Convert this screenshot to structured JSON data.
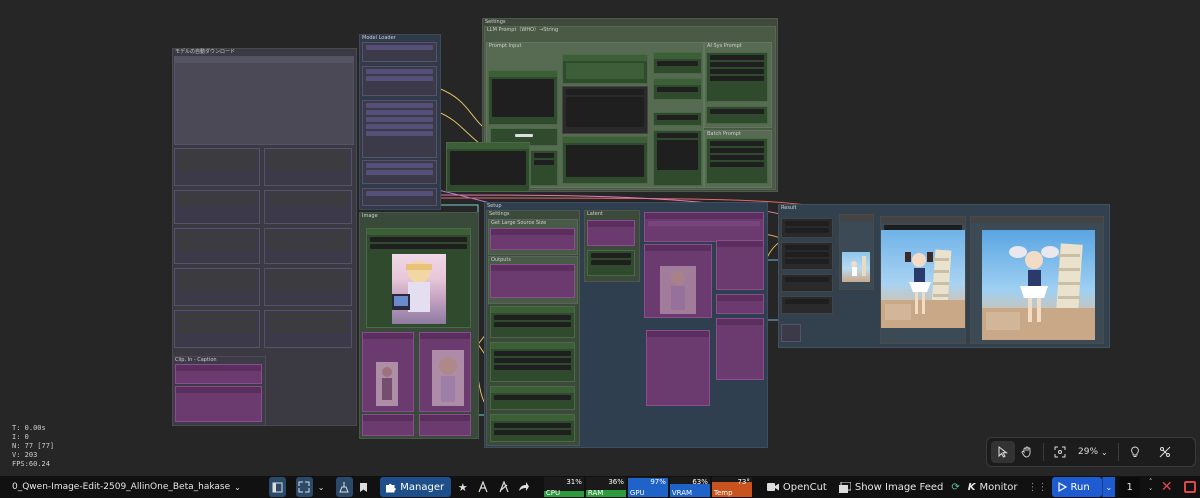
{
  "workflow": {
    "name": "0_Qwen-Image-Edit-2509_AllinOne_Beta_hakase"
  },
  "stats": {
    "time": "T: 0.00s",
    "iter": "I: 0",
    "nodes": "N: 77 [77]",
    "vertices": "V: 203",
    "fps": "FPS:60.24"
  },
  "groups": {
    "main_left": "モデルの自動ダウンロード",
    "model_loader": "Model Loader",
    "settings_top": "Settings",
    "lora_header": "LLM Prompt（WHO）→String",
    "image": "Image",
    "clip_caption": "Clip, In - Caption",
    "setup": "Setup",
    "settings_mid": "Settings",
    "latent": "Latent",
    "result": "Result",
    "prompt_input": "Prompt Input",
    "sys_prompt": "AI Sys Prompt",
    "batch_prompt": "Batch Prompt",
    "get_large": "Get Large Source Size",
    "outputs": "Outputs"
  },
  "canvas_tools": {
    "zoom": "29%",
    "icons": [
      "select-icon",
      "hand-icon",
      "fit-view-icon",
      "lightbulb-icon",
      "link-visibility-icon"
    ]
  },
  "toolbar": {
    "manager": "Manager",
    "meters": [
      {
        "label": "CPU",
        "value": "31%",
        "level": 0.31,
        "color": "#2e9a3e"
      },
      {
        "label": "RAM",
        "value": "36%",
        "level": 0.36,
        "color": "#2e9a3e"
      },
      {
        "label": "GPU",
        "value": "97%",
        "level": 0.97,
        "color": "#1f62c8"
      },
      {
        "label": "VRAM",
        "value": "63%",
        "level": 0.63,
        "color": "#1f62c8"
      },
      {
        "label": "Temp",
        "value": "73°",
        "level": 0.73,
        "color": "#c8531f"
      }
    ],
    "opencut": "OpenCut",
    "show_image_feed": "Show Image Feed",
    "monitor": "Monitor",
    "run": "Run",
    "batch_count": "1"
  }
}
